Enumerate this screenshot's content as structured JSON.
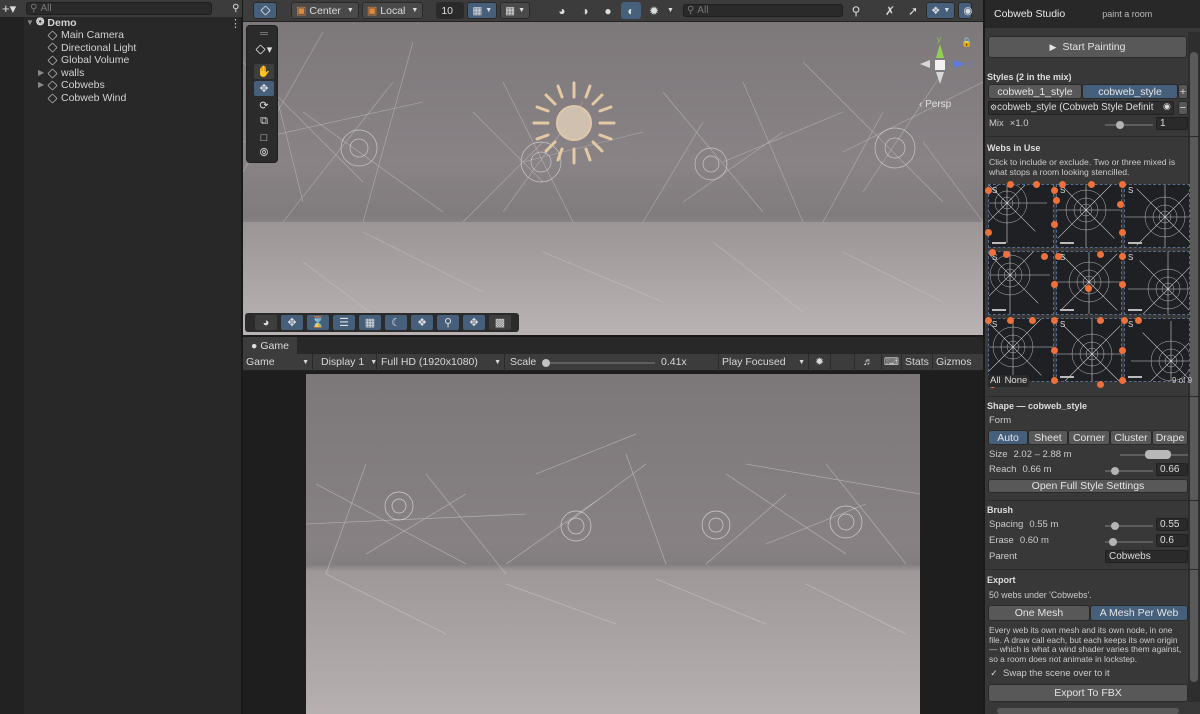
{
  "hierarchy": {
    "search_placeholder": "All",
    "root": "Demo",
    "items": [
      {
        "label": "Main Camera",
        "expandable": false
      },
      {
        "label": "Directional Light",
        "expandable": false
      },
      {
        "label": "Global Volume",
        "expandable": false
      },
      {
        "label": "walls",
        "expandable": true
      },
      {
        "label": "Cobwebs",
        "expandable": true
      },
      {
        "label": "Cobweb Wind",
        "expandable": false
      }
    ]
  },
  "scene_toolbar": {
    "pivot": "Center",
    "space": "Local",
    "snap_value": "10",
    "search_placeholder": "All"
  },
  "scene_view": {
    "camera_mode": "‹ Persp",
    "axes": [
      "y",
      "z"
    ]
  },
  "game": {
    "tab": "Game",
    "view_mode": "Game",
    "display": "Display 1",
    "resolution": "Full HD (1920x1080)",
    "scale_label": "Scale",
    "scale_value": "0.41x",
    "play_mode": "Play Focused",
    "stats": "Stats",
    "gizmos": "Gizmos"
  },
  "inspector": {
    "title": "Cobweb Studio",
    "subtitle": "paint a room",
    "start_button": "Start Painting",
    "styles_header": "Styles (2 in the mix)",
    "style_tabs": [
      "cobweb_1_style",
      "cobweb_style"
    ],
    "style_object": "cobweb_style (Cobweb Style Definit",
    "mix_label": "Mix",
    "mix_factor": "×1.0",
    "mix_value": "1",
    "webs_header": "Webs in Use",
    "webs_hint": "Click to include or exclude. Two or three mixed is what stops a room looking stencilled.",
    "all_label": "All",
    "none_label": "None",
    "count_label": "9 of 9",
    "thumb_tag": "S",
    "shape_header": "Shape — cobweb_style",
    "form_label": "Form",
    "forms": [
      "Auto",
      "Sheet",
      "Corner",
      "Cluster",
      "Drape"
    ],
    "size_label": "Size",
    "size_value": "2.02 – 2.88 m",
    "reach_label": "Reach",
    "reach_value": "0.66 m",
    "reach_field": "0.66",
    "reach_fraction": 0.66,
    "open_settings": "Open Full Style Settings",
    "brush_header": "Brush",
    "spacing_label": "Spacing",
    "spacing_value": "0.55 m",
    "spacing_field": "0.55",
    "erase_label": "Erase",
    "erase_value": "0.60 m",
    "erase_field": "0.6",
    "parent_label": "Parent",
    "parent_value": "Cobwebs",
    "export_header": "Export",
    "export_count": "50 webs under 'Cobwebs'.",
    "export_modes": [
      "One Mesh",
      "A Mesh Per Web"
    ],
    "export_desc": "Every web its own mesh and its own node, in one file. A draw call each, but each keeps its own origin — which is what a wind shader varies them against, so a room does not animate in lockstep.",
    "swap_label": "Swap the scene over to it",
    "swap_checked": true,
    "export_button": "Export To FBX"
  },
  "colors": {
    "accent": "#46607c",
    "handle": "#f0703a",
    "panel": "#383838"
  }
}
